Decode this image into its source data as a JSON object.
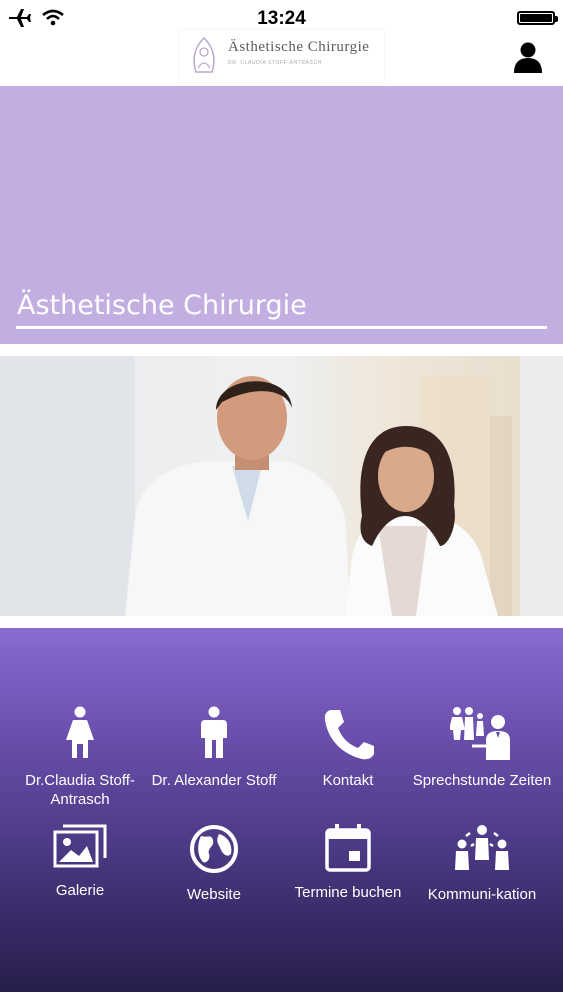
{
  "status": {
    "time": "13:24"
  },
  "header": {
    "logo_name": "Ästhetische Chirurgie",
    "logo_sub": "DR. CLAUDIA STOFF-ANTRASCH"
  },
  "hero": {
    "title": "Ästhetische Chirurgie"
  },
  "photo": {
    "description": "doctors-photo"
  },
  "menu": [
    {
      "label": "Dr.Claudia Stoff-Antrasch",
      "icon": "female-icon"
    },
    {
      "label": "Dr. Alexander Stoff",
      "icon": "male-icon"
    },
    {
      "label": "Kontakt",
      "icon": "phone-icon"
    },
    {
      "label": "Sprechstunde Zeiten",
      "icon": "consultation-icon"
    },
    {
      "label": "Galerie",
      "icon": "gallery-icon"
    },
    {
      "label": "Website",
      "icon": "globe-icon"
    },
    {
      "label": "Termine buchen",
      "icon": "calendar-icon"
    },
    {
      "label": "Kommuni-kation",
      "icon": "community-icon"
    }
  ],
  "colors": {
    "hero": "#c3aee2",
    "grid_top": "#8a6bd0",
    "grid_bottom": "#261d4a"
  }
}
